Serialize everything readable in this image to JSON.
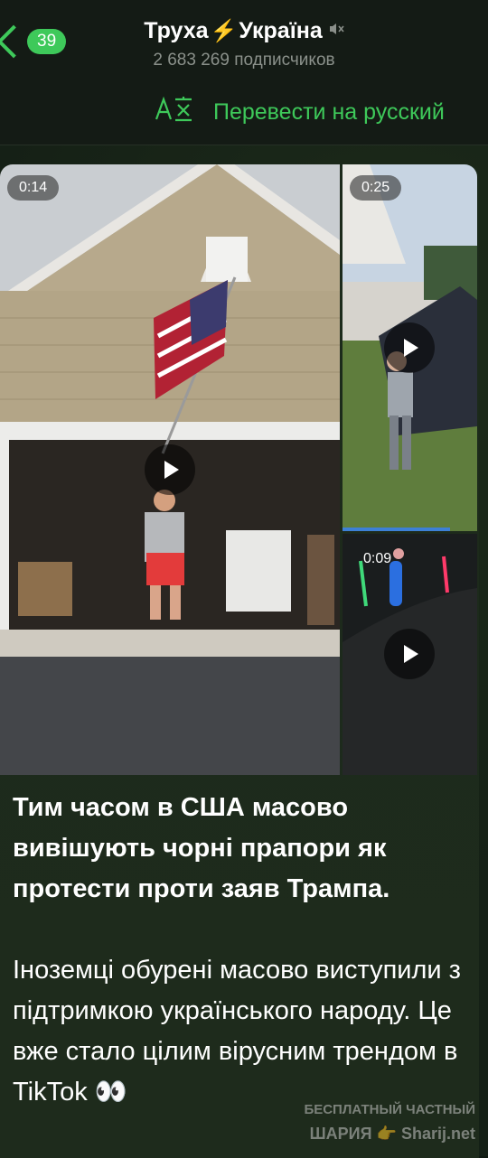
{
  "header": {
    "back_count": "39",
    "channel_name_part1": "Труха",
    "channel_name_bolt": "⚡",
    "channel_name_part2": "Україна",
    "subscribers": "2 683 269 подписчиков"
  },
  "translate_bar": {
    "label": "Перевести на русский"
  },
  "media": {
    "videos": [
      {
        "duration": "0:14",
        "progress_fraction": 0
      },
      {
        "duration": "0:25",
        "progress_fraction": 0.8
      },
      {
        "duration": "0:09",
        "progress_fraction": 0
      }
    ]
  },
  "message": {
    "bold_text": "Тим часом в США масово вивішують чорні прапори як протести проти заяв Трампа.",
    "body_text": "Іноземці обурені масово виступили з підтримкою українського народу. Це вже стало цілим вірусним трендом в TikTok 👀"
  },
  "watermark": {
    "line1": "БЕСПЛАТНЫЙ ЧАСТНЫЙ",
    "line2": "ШАРИЯ 👉 Sharij.net"
  },
  "colors": {
    "accent": "#3ec95a",
    "background": "#131d15",
    "bubble": "#1c2a1b"
  }
}
